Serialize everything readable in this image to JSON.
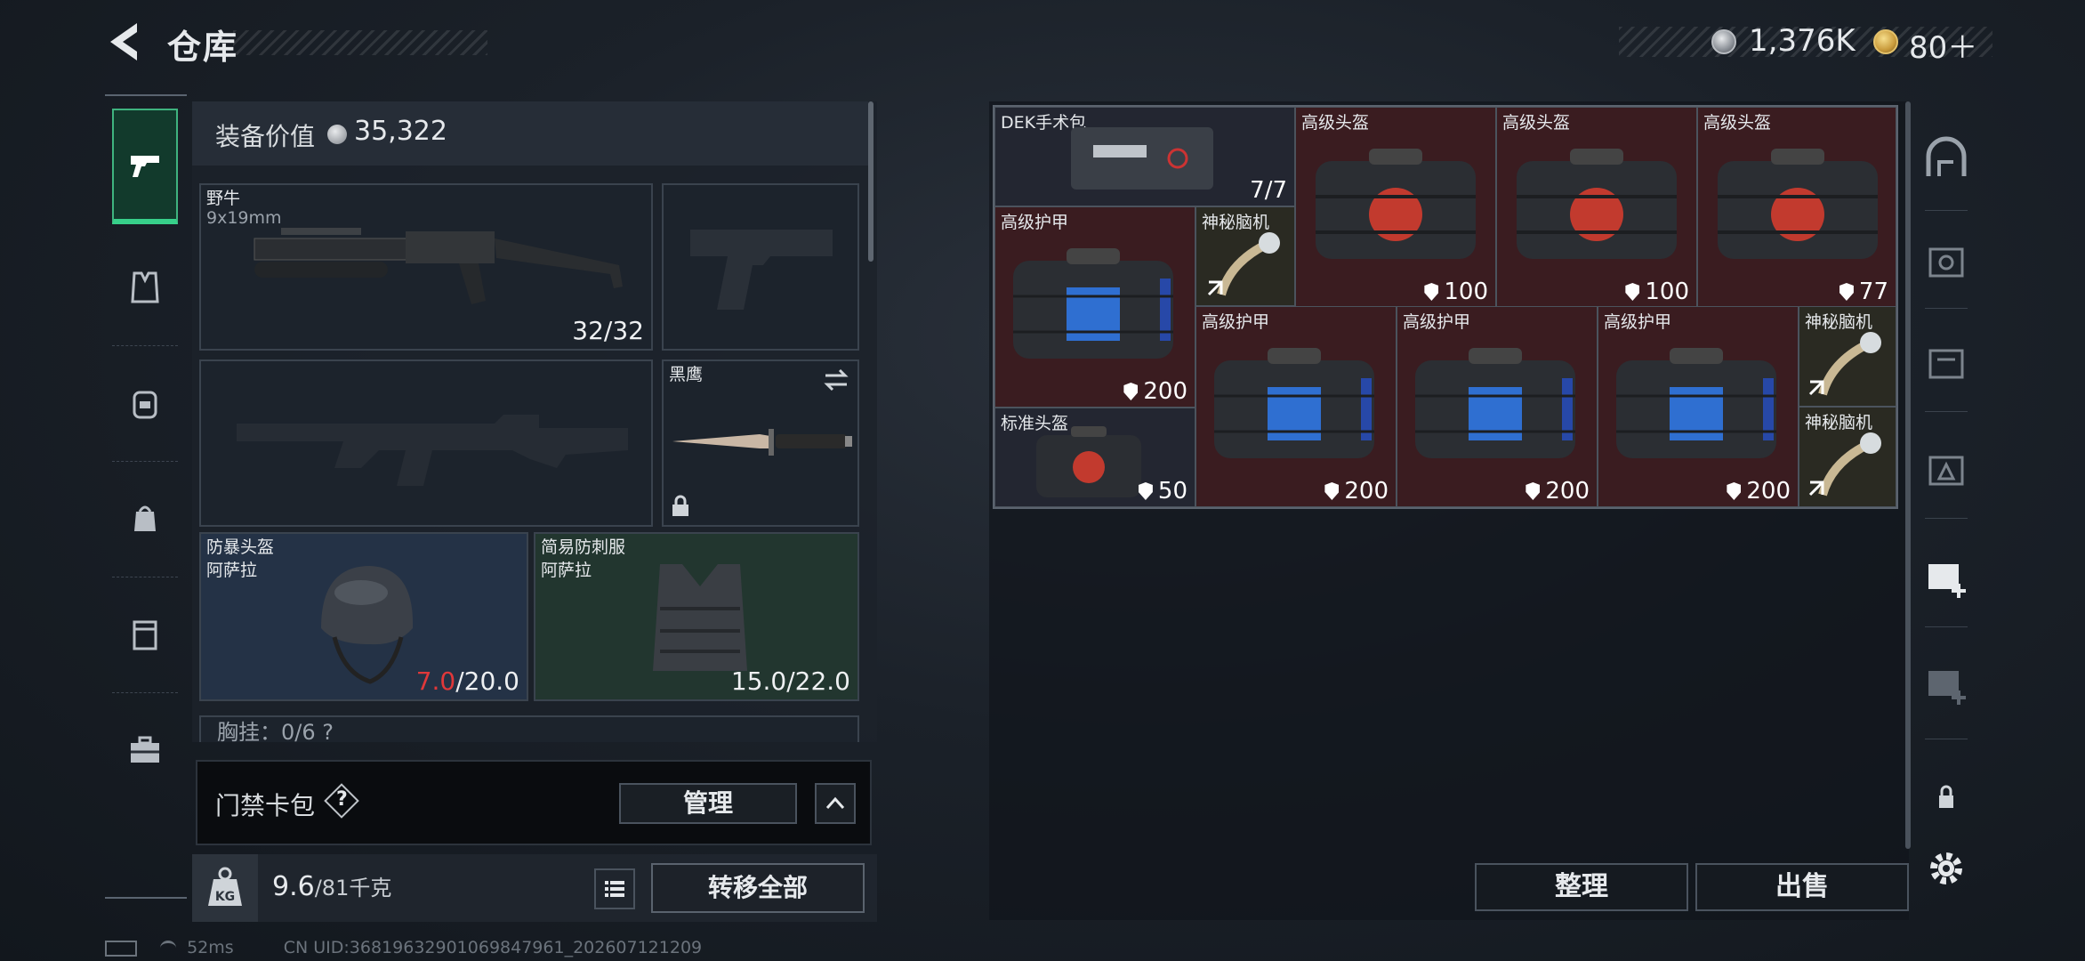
{
  "header": {
    "title": "仓库",
    "currency1": "1,376K",
    "currency2": "80＋"
  },
  "categories": [
    "pistol-icon",
    "vest-icon",
    "backpack-icon",
    "pouch-icon",
    "case-icon",
    "briefcase-icon"
  ],
  "equipment": {
    "value_label": "装备价值",
    "value": "35,322",
    "primary": {
      "name": "野牛",
      "ammo": "9x19mm",
      "count": "32/32"
    },
    "melee": {
      "name": "黑鹰"
    },
    "helmet": {
      "name": "防暴头盔",
      "sub": "阿萨拉",
      "durability_now": "7.0",
      "durability_max": "/20.0"
    },
    "armor": {
      "name": "简易防刺服",
      "sub": "阿萨拉",
      "durability": "15.0/22.0"
    },
    "chest_rig_partial": "胸挂：0/6  ?",
    "card_pack_label": "门禁卡包",
    "card_help": "?",
    "manage_label": "管理"
  },
  "weight": {
    "current": "9.6",
    "max": "/81千克",
    "kg_icon": "KG"
  },
  "transfer_label": "转移全部",
  "storage": {
    "items": [
      {
        "name": "DEK手术包",
        "value": "7/7"
      },
      {
        "name": "高级头盔",
        "value": "100"
      },
      {
        "name": "高级头盔",
        "value": "100"
      },
      {
        "name": "高级头盔",
        "value": "77"
      },
      {
        "name": "高级护甲",
        "value": "200"
      },
      {
        "name": "神秘脑机",
        "value": ""
      },
      {
        "name": "标准头盔",
        "value": "50"
      },
      {
        "name": "高级护甲",
        "value": "200"
      },
      {
        "name": "高级护甲",
        "value": "200"
      },
      {
        "name": "高级护甲",
        "value": "200"
      },
      {
        "name": "神秘脑机",
        "value": ""
      },
      {
        "name": "神秘脑机",
        "value": ""
      }
    ],
    "sort_label": "整理",
    "sell_label": "出售"
  },
  "status": {
    "ping": "52ms",
    "uid": "CN UID:3681963290106984796​1_202607121209"
  },
  "colors": {
    "accent_green": "#37d08a",
    "red_cell": "#3a1c20",
    "durability_red": "#e0383a"
  }
}
